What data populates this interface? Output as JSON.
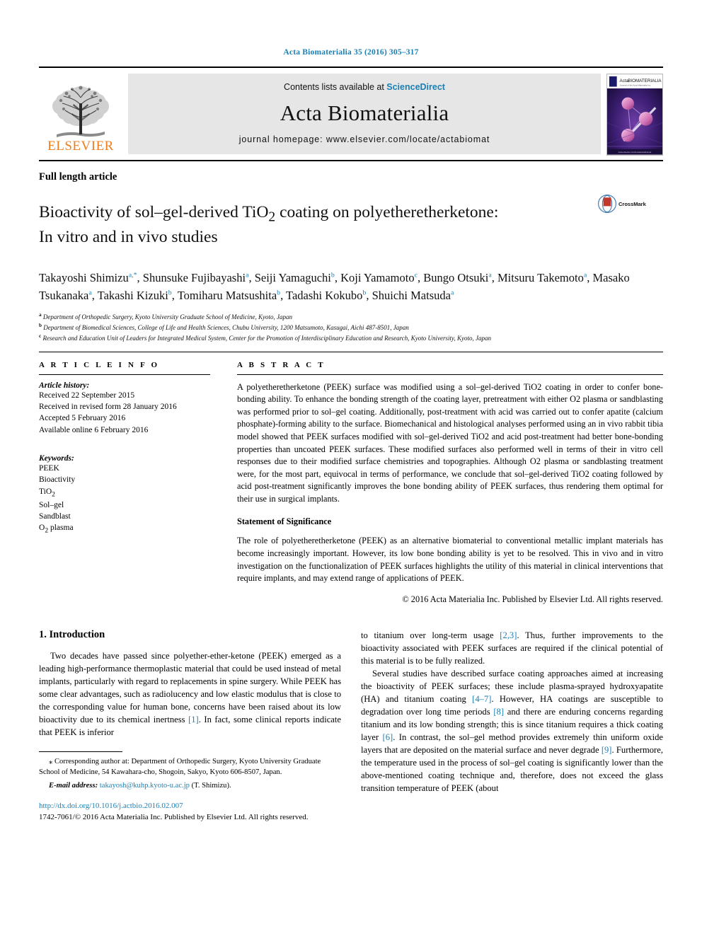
{
  "running_head": "Acta Biomaterialia 35 (2016) 305–317",
  "masthead": {
    "contents_prefix": "Contents lists available at ",
    "sciencedirect": "ScienceDirect",
    "journal_title": "Acta Biomaterialia",
    "homepage": "journal homepage: www.elsevier.com/locate/actabiomat",
    "publisher_wordmark": "ELSEVIER",
    "cover_title": "Acta BIOMATERIALIA"
  },
  "article": {
    "type": "Full length article",
    "title_line1": "Bioactivity of sol–gel-derived TiO",
    "title_sub1": "2",
    "title_line1b": " coating on polyetheretherketone:",
    "title_line2": "In vitro and in vivo studies",
    "crossmark_label": "CrossMark"
  },
  "authors": {
    "list": [
      {
        "name": "Takayoshi Shimizu",
        "sup": "a,*"
      },
      {
        "name": "Shunsuke Fujibayashi",
        "sup": "a"
      },
      {
        "name": "Seiji Yamaguchi",
        "sup": "b"
      },
      {
        "name": "Koji Yamamoto",
        "sup": "c"
      },
      {
        "name": "Bungo Otsuki",
        "sup": "a"
      },
      {
        "name": "Mitsuru Takemoto",
        "sup": "a"
      },
      {
        "name": "Masako Tsukanaka",
        "sup": "a"
      },
      {
        "name": "Takashi Kizuki",
        "sup": "b"
      },
      {
        "name": "Tomiharu Matsushita",
        "sup": "b"
      },
      {
        "name": "Tadashi Kokubo",
        "sup": "b"
      },
      {
        "name": "Shuichi Matsuda",
        "sup": "a"
      }
    ],
    "affiliations": [
      {
        "mark": "a",
        "text": "Department of Orthopedic Surgery, Kyoto University Graduate School of Medicine, Kyoto, Japan"
      },
      {
        "mark": "b",
        "text": "Department of Biomedical Sciences, College of Life and Health Sciences, Chubu University, 1200 Matsumoto, Kasugai, Aichi 487-8501, Japan"
      },
      {
        "mark": "c",
        "text": "Research and Education Unit of Leaders for Integrated Medical System, Center for the Promotion of Interdisciplinary Education and Research, Kyoto University, Kyoto, Japan"
      }
    ]
  },
  "article_info": {
    "heading": "A R T I C L E   I N F O",
    "history_label": "Article history:",
    "history": [
      "Received 22 September 2015",
      "Received in revised form 28 January 2016",
      "Accepted 5 February 2016",
      "Available online 6 February 2016"
    ],
    "keywords_label": "Keywords:",
    "keywords": [
      "PEEK",
      "Bioactivity",
      "TiO2",
      "Sol–gel",
      "Sandblast",
      "O2 plasma"
    ]
  },
  "abstract": {
    "heading": "A B S T R A C T",
    "paragraph": "A polyetheretherketone (PEEK) surface was modified using a sol–gel-derived TiO2 coating in order to confer bone-bonding ability. To enhance the bonding strength of the coating layer, pretreatment with either O2 plasma or sandblasting was performed prior to sol–gel coating. Additionally, post-treatment with acid was carried out to confer apatite (calcium phosphate)-forming ability to the surface. Biomechanical and histological analyses performed using an in vivo rabbit tibia model showed that PEEK surfaces modified with sol–gel-derived TiO2 and acid post-treatment had better bone-bonding properties than uncoated PEEK surfaces. These modified surfaces also performed well in terms of their in vitro cell responses due to their modified surface chemistries and topographies. Although O2 plasma or sandblasting treatment were, for the most part, equivocal in terms of performance, we conclude that sol–gel-derived TiO2 coating followed by acid post-treatment significantly improves the bone bonding ability of PEEK surfaces, thus rendering them optimal for their use in surgical implants.",
    "significance_heading": "Statement of Significance",
    "significance": "The role of polyetheretherketone (PEEK) as an alternative biomaterial to conventional metallic implant materials has become increasingly important. However, its low bone bonding ability is yet to be resolved. This in vivo and in vitro investigation on the functionalization of PEEK surfaces highlights the utility of this material in clinical interventions that require implants, and may extend range of applications of PEEK.",
    "copyright": "© 2016 Acta Materialia Inc. Published by Elsevier Ltd. All rights reserved."
  },
  "introduction": {
    "heading": "1. Introduction",
    "left_paragraph": "Two decades have passed since polyether-ether-ketone (PEEK) emerged as a leading high-performance thermoplastic material that could be used instead of metal implants, particularly with regard to replacements in spine surgery. While PEEK has some clear advantages, such as radiolucency and low elastic modulus that is close to the corresponding value for human bone, concerns have been raised about its low bioactivity due to its chemical inertness [1]. In fact, some clinical reports indicate that PEEK is inferior",
    "right_paragraph_1": "to titanium over long-term usage [2,3]. Thus, further improvements to the bioactivity associated with PEEK surfaces are required if the clinical potential of this material is to be fully realized.",
    "right_paragraph_2": "Several studies have described surface coating approaches aimed at increasing the bioactivity of PEEK surfaces; these include plasma-sprayed hydroxyapatite (HA) and titanium coating [4–7]. However, HA coatings are susceptible to degradation over long time periods [8] and there are enduring concerns regarding titanium and its low bonding strength; this is since titanium requires a thick coating layer [6]. In contrast, the sol–gel method provides extremely thin uniform oxide layers that are deposited on the material surface and never degrade [9]. Furthermore, the temperature used in the process of sol–gel coating is significantly lower than the above-mentioned coating technique and, therefore, does not exceed the glass transition temperature of PEEK (about"
  },
  "footnotes": {
    "corresponding": "⁎ Corresponding author at: Department of Orthopedic Surgery, Kyoto University Graduate School of Medicine, 54 Kawahara-cho, Shogoin, Sakyo, Kyoto 606-8507, Japan.",
    "email_label": "E-mail address:",
    "email": "takayosh@kuhp.kyoto-u.ac.jp",
    "email_suffix": "(T. Shimizu).",
    "doi": "http://dx.doi.org/10.1016/j.actbio.2016.02.007",
    "issn_line": "1742-7061/© 2016 Acta Materialia Inc. Published by Elsevier Ltd. All rights reserved."
  },
  "colors": {
    "link": "#1a7fb5",
    "elsevier_orange": "#f07d1a",
    "contents_bg": "#e6e6e6"
  }
}
